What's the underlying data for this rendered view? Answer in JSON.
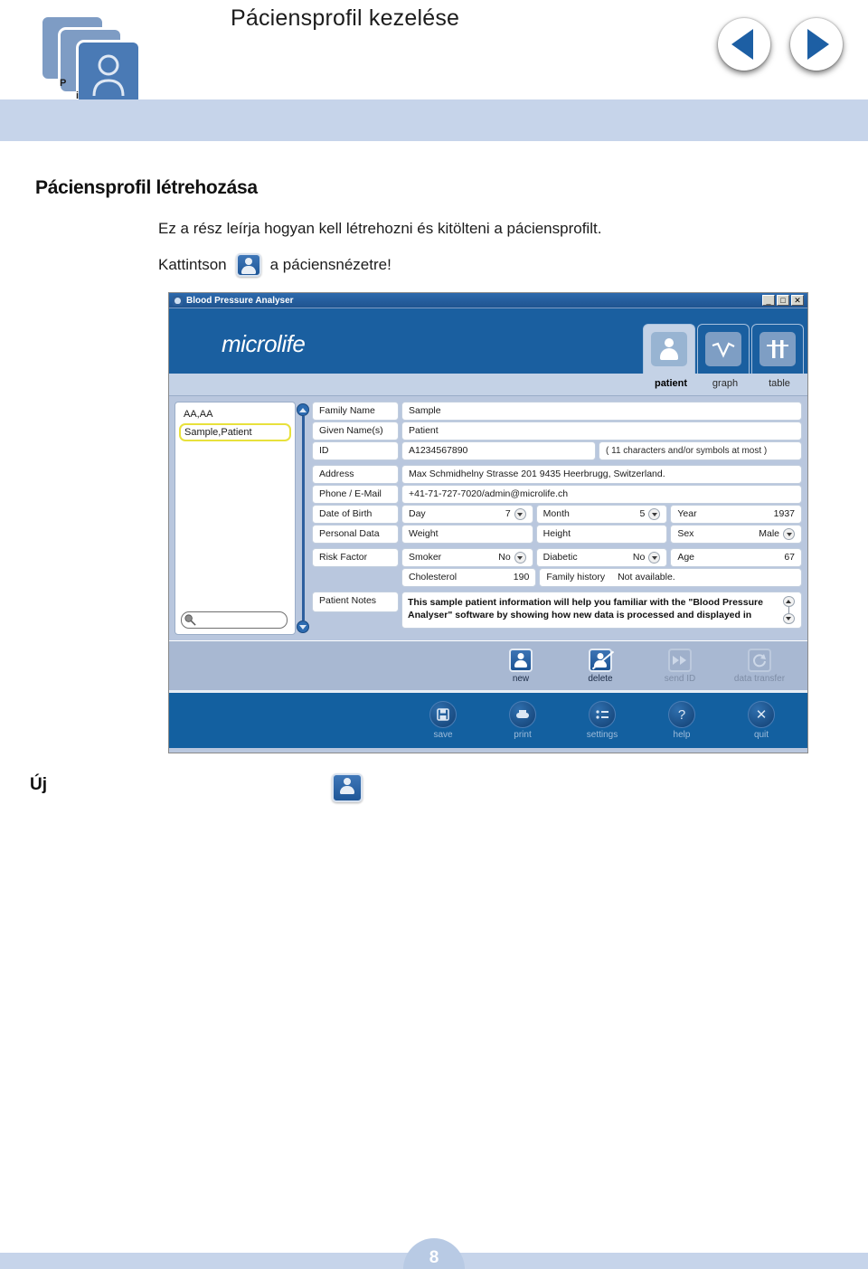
{
  "header": {
    "title": "Páciensprofil kezelése",
    "logo_letters": [
      "P",
      "i"
    ],
    "nav_prev_label": "prev-arrow",
    "nav_next_label": "next-arrow"
  },
  "content": {
    "section_title": "Páciensprofil létrehozása",
    "paragraph_1": "Ez a rész leírja hogyan kell létrehozni és kitölteni a páciensprofilt.",
    "paragraph_2_before": "Kattintson",
    "paragraph_2_after": "a páciensnézetre!",
    "caption_uj": "Új"
  },
  "app": {
    "titlebar": {
      "title": "Blood Pressure Analyser",
      "minimize": "_",
      "maximize": "□",
      "close": "✕"
    },
    "brand": "microlife",
    "tabs": [
      {
        "label": "patient",
        "active": true
      },
      {
        "label": "graph",
        "active": false
      },
      {
        "label": "table",
        "active": false
      }
    ],
    "patient_list": {
      "items": [
        {
          "name": "AA,AA",
          "selected": false
        },
        {
          "name": "Sample,Patient",
          "selected": true
        }
      ],
      "search_value": ""
    },
    "form": {
      "group1": [
        {
          "label": "Family Name",
          "value": "Sample"
        },
        {
          "label": "Given Name(s)",
          "value": "Patient"
        },
        {
          "label": "ID",
          "value": "A1234567890",
          "hint": "( 11 characters and/or symbols at most )"
        }
      ],
      "group2": [
        {
          "label": "Address",
          "value": "Max Schmidhelny Strasse 201 9435 Heerbrugg, Switzerland."
        },
        {
          "label": "Phone / E-Mail",
          "value": "+41-71-727-7020/admin@microlife.ch"
        }
      ],
      "date_of_birth": {
        "label": "Date of Birth",
        "cells": [
          {
            "key": "Day",
            "value": "7",
            "spinner": true
          },
          {
            "key": "Month",
            "value": "5",
            "spinner": true
          },
          {
            "key": "Year",
            "value": "1937",
            "spinner": false
          }
        ]
      },
      "personal_data": {
        "label": "Personal Data",
        "cells": [
          {
            "key": "Weight",
            "value": "",
            "spinner": false
          },
          {
            "key": "Height",
            "value": "",
            "spinner": false
          },
          {
            "key": "Sex",
            "value": "Male",
            "spinner": true
          }
        ]
      },
      "risk_factor": {
        "label": "Risk Factor",
        "row1": [
          {
            "key": "Smoker",
            "value": "No",
            "spinner": true
          },
          {
            "key": "Diabetic",
            "value": "No",
            "spinner": true
          },
          {
            "key": "Age",
            "value": "67",
            "spinner": false
          }
        ],
        "row2": [
          {
            "key": "Cholesterol",
            "value": "190",
            "spinner": false
          },
          {
            "key": "Family history",
            "value": "Not available.",
            "spinner": false
          }
        ]
      },
      "patient_notes": {
        "label": "Patient Notes",
        "value": "This sample patient information will help you familiar with the \"Blood Pressure Analyser\" software by showing how new data is processed and displayed in"
      }
    },
    "toolbar_mid": [
      {
        "label": "new",
        "icon": "patient-new-icon",
        "enabled": true
      },
      {
        "label": "delete",
        "icon": "patient-delete-icon",
        "enabled": true
      },
      {
        "label": "send ID",
        "icon": "send-id-icon",
        "enabled": false
      },
      {
        "label": "data transfer",
        "icon": "data-transfer-icon",
        "enabled": false
      }
    ],
    "toolbar_bottom": [
      {
        "label": "save",
        "icon": "floppy-icon",
        "glyph": "💾"
      },
      {
        "label": "print",
        "icon": "printer-icon",
        "glyph": "⎙"
      },
      {
        "label": "settings",
        "icon": "settings-list-icon",
        "glyph": "≡"
      },
      {
        "label": "help",
        "icon": "question-mark-icon",
        "glyph": "?"
      },
      {
        "label": "quit",
        "icon": "close-x-icon",
        "glyph": "✕"
      }
    ]
  },
  "footer": {
    "page_number": "8"
  },
  "colors": {
    "header_band": "#c6d4ea",
    "app_brand_blue": "#1a5fa0",
    "app_bottom_blue": "#1360a0",
    "toolbar_mid": "#a8b8d2",
    "selection_yellow": "#e8e13c",
    "nav_triangle": "#1d5fa4"
  }
}
